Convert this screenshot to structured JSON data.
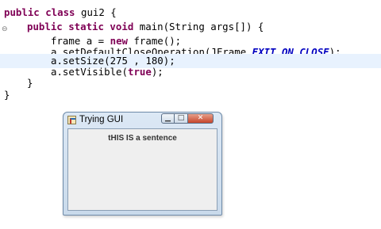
{
  "code": {
    "line1": {
      "kw": "public class",
      "rest": " gui2 {"
    },
    "line2": {
      "kw": "public static void",
      "rest": " main(String args[]) {"
    },
    "line3": {
      "pre": "frame a = ",
      "kw": "new",
      "rest": " frame();"
    },
    "line4": {
      "pre": "a.setDefaultCloseOperation(JFrame.",
      "constant": "EXIT_ON_CLOSE",
      "post": ");"
    },
    "line5": "a.setSize(275 , 180);",
    "line6": {
      "pre": "a.setVisible(",
      "kw": "true",
      "post": ");"
    },
    "line7": "}",
    "line8": "}",
    "fold_marker": "⊖"
  },
  "colors": {
    "keyword": "#7f0055",
    "static_field": "#0000c0",
    "current_line": "#e8f2fe"
  },
  "window": {
    "title": "Trying GUI",
    "minimize_glyph": "▁",
    "maximize_glyph": "□",
    "close_glyph": "✕",
    "label": "tHIS IS  a sentence"
  }
}
